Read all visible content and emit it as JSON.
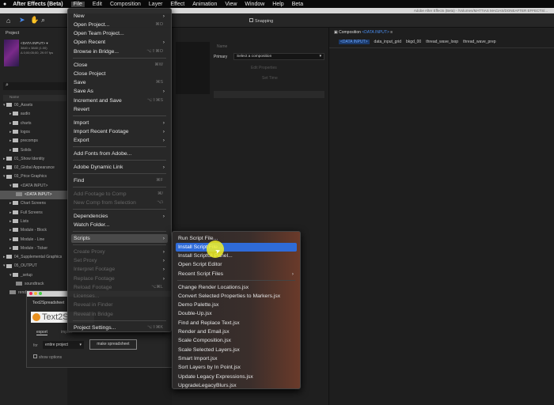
{
  "menubar": {
    "app": "After Effects (Beta)",
    "items": [
      "File",
      "Edit",
      "Composition",
      "Layer",
      "Effect",
      "Animation",
      "View",
      "Window",
      "Help",
      "Beta"
    ]
  },
  "window_title": "Adobe After Effects (Beta) - /Volumes/MATTIAS MACIAS/DONEAFTER EFFECTS/...",
  "toolbar": {
    "snapping": "Snapping"
  },
  "project": {
    "title": "Project",
    "comp_name": "<DATA INPUT> ▾",
    "comp_size": "3840 x 3840 (1.00)",
    "comp_dur": "Δ 0;00;05;00, 29.97 fps",
    "col_name": "Name",
    "tree": [
      {
        "label": "00_Assets",
        "depth": 0,
        "type": "folder",
        "open": true
      },
      {
        "label": "audio",
        "depth": 1,
        "type": "folder"
      },
      {
        "label": "charts",
        "depth": 1,
        "type": "folder"
      },
      {
        "label": "logos",
        "depth": 1,
        "type": "folder"
      },
      {
        "label": "precomps",
        "depth": 1,
        "type": "folder"
      },
      {
        "label": "Solids",
        "depth": 1,
        "type": "folder"
      },
      {
        "label": "01_Show Identity",
        "depth": 0,
        "type": "folder"
      },
      {
        "label": "02_Global Appearance",
        "depth": 0,
        "type": "folder"
      },
      {
        "label": "03_Price Graphics",
        "depth": 0,
        "type": "folder",
        "open": true
      },
      {
        "label": "<DATA INPUT>",
        "depth": 1,
        "type": "folder",
        "open": true
      },
      {
        "label": "<DATA INPUT>",
        "depth": 2,
        "type": "comp",
        "selected": true
      },
      {
        "label": "Chart Screens",
        "depth": 1,
        "type": "folder"
      },
      {
        "label": "Full Screens",
        "depth": 1,
        "type": "folder"
      },
      {
        "label": "Lists",
        "depth": 1,
        "type": "folder"
      },
      {
        "label": "Module - Block",
        "depth": 1,
        "type": "folder"
      },
      {
        "label": "Module - Line",
        "depth": 1,
        "type": "folder"
      },
      {
        "label": "Module - Ticker",
        "depth": 1,
        "type": "folder"
      },
      {
        "label": "04_Supplemental Graphics",
        "depth": 0,
        "type": "folder"
      },
      {
        "label": "05_OUTPUT",
        "depth": 0,
        "type": "folder",
        "open": true
      },
      {
        "label": "_setup",
        "depth": 1,
        "type": "folder",
        "open": true
      },
      {
        "label": "soundtrack",
        "depth": 2,
        "type": "comp"
      },
      {
        "label": "render_composition",
        "depth": 1,
        "type": "comp"
      }
    ]
  },
  "file_menu": [
    {
      "label": "New",
      "sub": true
    },
    {
      "label": "Open Project...",
      "sc": "⌘O"
    },
    {
      "label": "Open Team Project..."
    },
    {
      "label": "Open Recent",
      "sub": true
    },
    {
      "label": "Browse in Bridge...",
      "sc": "⌥⇧⌘O"
    },
    {
      "label": "Close",
      "sc": "⌘W",
      "sep": true
    },
    {
      "label": "Close Project"
    },
    {
      "label": "Save",
      "sc": "⌘S"
    },
    {
      "label": "Save As",
      "sub": true
    },
    {
      "label": "Increment and Save",
      "sc": "⌥⇧⌘S"
    },
    {
      "label": "Revert"
    },
    {
      "label": "Import",
      "sub": true,
      "sep": true
    },
    {
      "label": "Import Recent Footage",
      "sub": true
    },
    {
      "label": "Export",
      "sub": true
    },
    {
      "label": "Add Fonts from Adobe...",
      "sep": true
    },
    {
      "label": "Adobe Dynamic Link",
      "sub": true,
      "sep": true
    },
    {
      "label": "Find",
      "sc": "⌘F",
      "sep": true
    },
    {
      "label": "Add Footage to Comp",
      "sc": "⌘/",
      "dis": true,
      "sep": true
    },
    {
      "label": "New Comp from Selection",
      "sc": "⌥\\",
      "dis": true
    },
    {
      "label": "Dependencies",
      "sub": true,
      "sep": true
    },
    {
      "label": "Watch Folder..."
    },
    {
      "label": "Scripts",
      "sub": true,
      "sep": true,
      "hl": true
    },
    {
      "label": "Create Proxy",
      "sub": true,
      "dis": true,
      "sep": true
    },
    {
      "label": "Set Proxy",
      "sub": true,
      "dis": true
    },
    {
      "label": "Interpret Footage",
      "sub": true,
      "dis": true
    },
    {
      "label": "Replace Footage",
      "sub": true,
      "dis": true
    },
    {
      "label": "Reload Footage",
      "sc": "⌥⌘L",
      "dis": true
    },
    {
      "label": "Licenses...",
      "dis": true
    },
    {
      "label": "Reveal in Finder",
      "dis": true
    },
    {
      "label": "Reveal in Bridge",
      "dis": true
    },
    {
      "label": "Project Settings...",
      "sc": "⌥⇧⌘K",
      "sep": true
    }
  ],
  "scripts_menu": [
    {
      "label": "Run Script File..."
    },
    {
      "label": "Install Script File...",
      "sel": true
    },
    {
      "label": "Install ScriptUI Panel..."
    },
    {
      "label": "Open Script Editor"
    },
    {
      "label": "Recent Script Files",
      "sub": true
    },
    {
      "label": "Change Render Locations.jsx",
      "sep": true
    },
    {
      "label": "Convert Selected Properties to Markers.jsx"
    },
    {
      "label": "Demo Palette.jsx"
    },
    {
      "label": "Double-Up.jsx"
    },
    {
      "label": "Find and Replace Text.jsx"
    },
    {
      "label": "Render and Email.jsx"
    },
    {
      "label": "Scale Composition.jsx"
    },
    {
      "label": "Scale Selected Layers.jsx"
    },
    {
      "label": "Smart Import.jsx"
    },
    {
      "label": "Sort Layers by In Point.jsx"
    },
    {
      "label": "Update Legacy Expressions.jsx"
    },
    {
      "label": "UpgradeLegacyBlurs.jsx"
    }
  ],
  "middle": {
    "name_label": "Name",
    "primary_label": "Primary",
    "select_placeholder": "Select a composition",
    "btn1": "Edit Properties",
    "btn2": "Set Time"
  },
  "composition": {
    "panel_title": "Composition",
    "comp": "<DATA INPUT>",
    "tabs": [
      "<DATA INPUT>",
      "data_input_grid",
      "bkgd_00",
      "thread_wave_loop",
      "thread_wave_prep"
    ]
  },
  "dialog": {
    "title": "Text2Spreadsheet",
    "logo": "Text2S",
    "tab_export": "export",
    "tab_import": "import",
    "for_label": "for",
    "for_value": "entire project",
    "make_btn": "make spreadsheet",
    "show_options": "show options"
  }
}
